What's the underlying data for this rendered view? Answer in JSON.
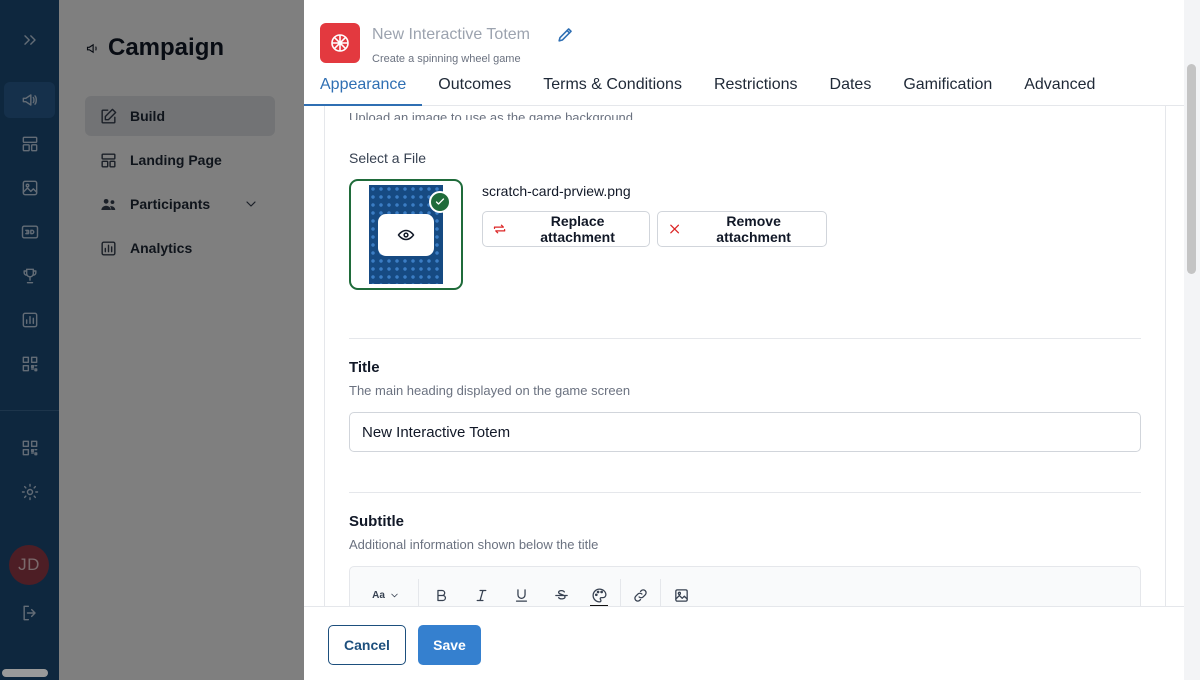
{
  "rail": {
    "items": [
      {
        "icon": "expand-icon"
      },
      {
        "icon": "megaphone-icon"
      },
      {
        "icon": "layout-icon"
      },
      {
        "icon": "image-icon"
      },
      {
        "icon": "3d-icon"
      },
      {
        "icon": "trophy-icon"
      },
      {
        "icon": "chart-icon"
      },
      {
        "icon": "qr-icon"
      },
      {
        "icon": "qr-icon"
      },
      {
        "icon": "gear-icon"
      },
      {
        "icon": "logout-icon"
      }
    ],
    "avatar_initials": "JD"
  },
  "campaign": {
    "title": "Campaign",
    "nav": [
      {
        "label": "Build"
      },
      {
        "label": "Landing Page"
      },
      {
        "label": "Participants"
      },
      {
        "label": "Analytics"
      }
    ]
  },
  "drawer": {
    "game_name": "New Interactive Totem",
    "game_description": "Create a spinning wheel game",
    "tabs": [
      "Appearance",
      "Outcomes",
      "Terms & Conditions",
      "Restrictions",
      "Dates",
      "Gamification",
      "Advanced"
    ],
    "active_tab": "Appearance"
  },
  "background": {
    "hint": "Upload an image to use as the game background",
    "select_label": "Select a File",
    "file_name": "scratch-card-prview.png",
    "replace_label": "Replace attachment",
    "remove_label": "Remove attachment"
  },
  "title_field": {
    "label": "Title",
    "help": "The main heading displayed on the game screen",
    "value": "New Interactive Totem"
  },
  "subtitle_field": {
    "label": "Subtitle",
    "help": "Additional information shown below the title",
    "toolbar_font_label": "Aa"
  },
  "footer": {
    "cancel_label": "Cancel",
    "save_label": "Save"
  },
  "colors": {
    "rail": "#1d4f7d",
    "accent": "#2f6fb3",
    "save": "#3580cf",
    "game_icon": "#e3393f",
    "success": "#1f6b3a",
    "danger": "#dc2626"
  }
}
